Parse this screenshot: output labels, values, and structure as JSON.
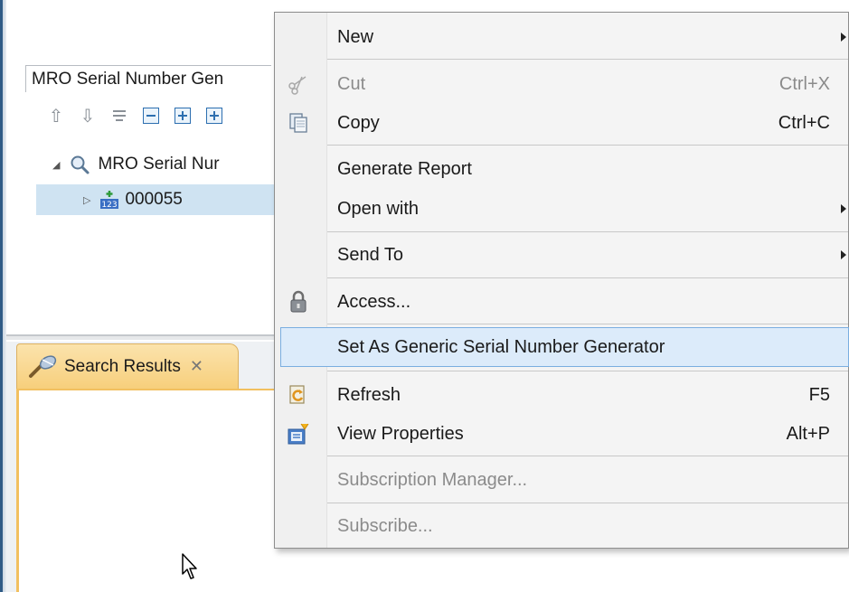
{
  "search_view": {
    "tab_label": "Search Results",
    "tab_close": "✕",
    "subtitle": "MRO Serial Number Gen",
    "tree": {
      "root_label": "MRO Serial Nur",
      "child_label": "000055",
      "child_icon_text": "123"
    }
  },
  "context_menu": {
    "items": [
      {
        "label": "New",
        "shortcut": "",
        "icon": "none",
        "submenu": true,
        "enabled": true
      },
      {
        "label": "Cut",
        "shortcut": "Ctrl+X",
        "icon": "scissors-icon",
        "submenu": false,
        "enabled": false
      },
      {
        "label": "Copy",
        "shortcut": "Ctrl+C",
        "icon": "copy-icon",
        "submenu": false,
        "enabled": true
      },
      {
        "label": "Generate Report",
        "shortcut": "",
        "icon": "none",
        "submenu": false,
        "enabled": true
      },
      {
        "label": "Open with",
        "shortcut": "",
        "icon": "none",
        "submenu": true,
        "enabled": true
      },
      {
        "label": "Send To",
        "shortcut": "",
        "icon": "none",
        "submenu": true,
        "enabled": true
      },
      {
        "label": "Access...",
        "shortcut": "",
        "icon": "lock-icon",
        "submenu": false,
        "enabled": true
      },
      {
        "label": "Set As Generic Serial Number Generator",
        "shortcut": "",
        "icon": "none",
        "submenu": false,
        "enabled": true,
        "highlighted": true
      },
      {
        "label": "Refresh",
        "shortcut": "F5",
        "icon": "refresh-icon",
        "submenu": false,
        "enabled": true
      },
      {
        "label": "View Properties",
        "shortcut": "Alt+P",
        "icon": "properties-icon",
        "submenu": false,
        "enabled": true
      },
      {
        "label": "Subscription Manager...",
        "shortcut": "",
        "icon": "none",
        "submenu": false,
        "enabled": false
      },
      {
        "label": "Subscribe...",
        "shortcut": "",
        "icon": "none",
        "submenu": false,
        "enabled": false
      }
    ]
  },
  "colors": {
    "tab_orange": "#f7cf7c",
    "selection_blue": "#cfe3f2",
    "menu_highlight": "#dcebfa"
  }
}
